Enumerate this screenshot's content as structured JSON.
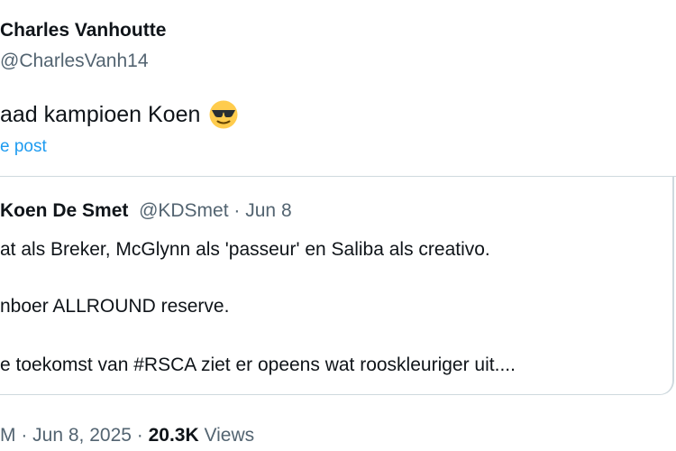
{
  "post": {
    "author_name": "Charles Vanhoutte",
    "author_handle": "@CharlesVanh14",
    "text": "aad kampioen Koen",
    "emoji_icon": "smiling-face-with-sunglasses-icon",
    "quote_link": "e post"
  },
  "quoted": {
    "name": "Koen De Smet",
    "handle": "@KDSmet",
    "separator": " · ",
    "date": "Jun 8",
    "lines": [
      "at als Breker, McGlynn als 'passeur' en Saliba als creativo.",
      "nboer ALLROUND reserve.",
      "e toekomst van #RSCA ziet er opeens wat rooskleuriger uit...."
    ]
  },
  "footer": {
    "time_fragment": "M",
    "date": "Jun 8, 2025",
    "views_count": "20.3K",
    "views_label": "Views",
    "separator": " · "
  },
  "colors": {
    "text": "#0f1419",
    "secondary": "#536471",
    "link": "#1d9bf0",
    "border": "#cfd9de"
  }
}
